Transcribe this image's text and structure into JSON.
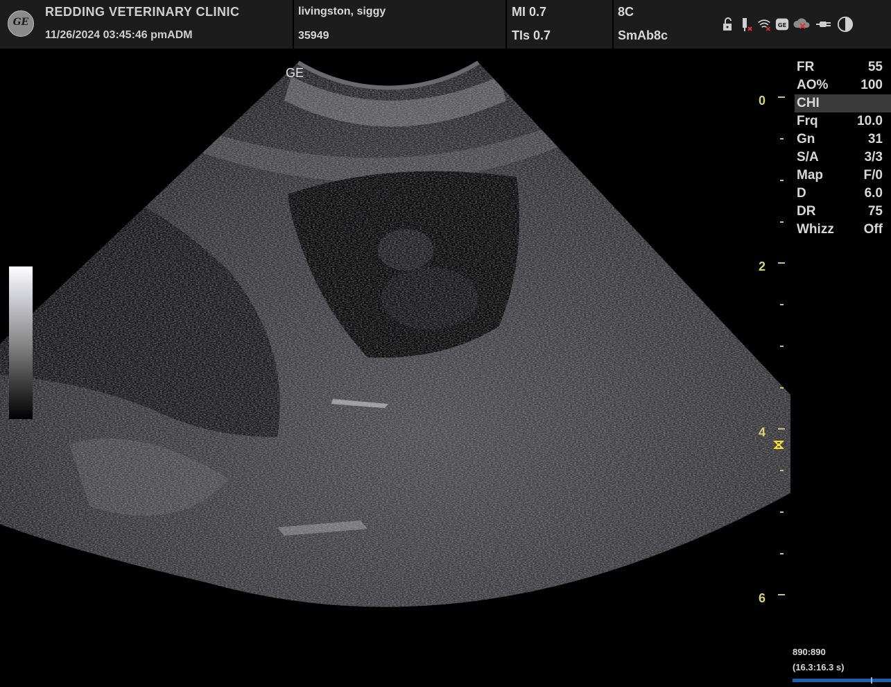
{
  "header": {
    "clinic_name": "REDDING VETERINARY CLINIC",
    "datetime": "11/26/2024 03:45:46 pmADM",
    "patient_name": "livingston, siggy",
    "patient_id": "35949",
    "mi": "MI 0.7",
    "tis": "TIs 0.7",
    "probe": "8C",
    "preset": "SmAb8c",
    "logo_icon": "ge-logo-icon",
    "status_icons": [
      "unlock-icon",
      "usb-disconnected-icon",
      "wifi-off-icon",
      "ge-service-icon",
      "cloud-off-icon",
      "power-plug-icon",
      "contrast-icon"
    ]
  },
  "image": {
    "ge_orientation_mark": "GE",
    "depth_labels": [
      "0",
      "2",
      "4",
      "6"
    ]
  },
  "params": [
    {
      "label": "FR",
      "value": "55"
    },
    {
      "label": "AO%",
      "value": "100"
    },
    {
      "label": "CHI",
      "value": ""
    },
    {
      "label": "Frq",
      "value": "10.0"
    },
    {
      "label": "Gn",
      "value": "31"
    },
    {
      "label": "S/A",
      "value": "3/3"
    },
    {
      "label": "Map",
      "value": "F/0"
    },
    {
      "label": "D",
      "value": "6.0"
    },
    {
      "label": "DR",
      "value": "75"
    },
    {
      "label": "Whizz",
      "value": "Off"
    }
  ],
  "cine": {
    "frames": "890:890",
    "time": "(16.3:16.3 s)"
  },
  "colors": {
    "header_bg": "#1c1c1c",
    "depth_scale": "#d7d27a",
    "focal_marker": "#f0e030",
    "cine_bar": "#1a5fb4"
  }
}
